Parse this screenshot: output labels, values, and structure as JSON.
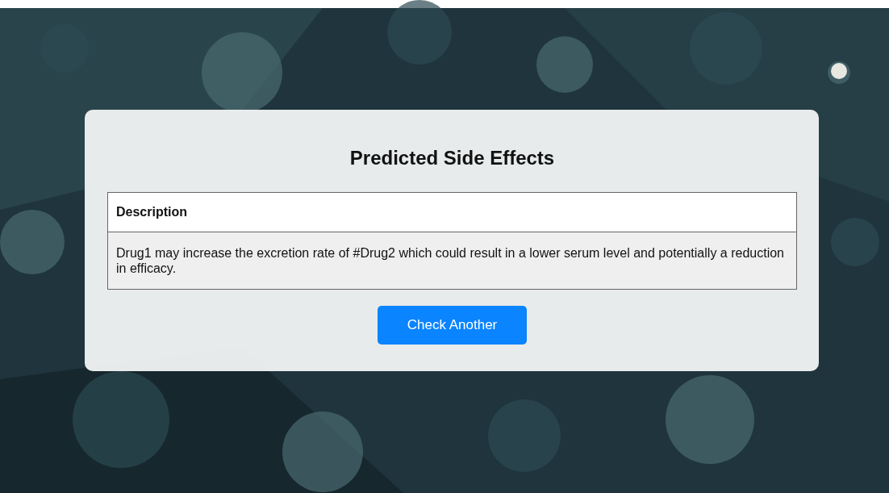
{
  "card": {
    "title": "Predicted Side Effects",
    "table": {
      "columns": [
        "Description"
      ],
      "rows": [
        [
          "Drug1 may increase the excretion rate of #Drug2 which could result in a lower serum level and potentially a reduction in efficacy."
        ]
      ]
    },
    "button": "Check Another"
  }
}
